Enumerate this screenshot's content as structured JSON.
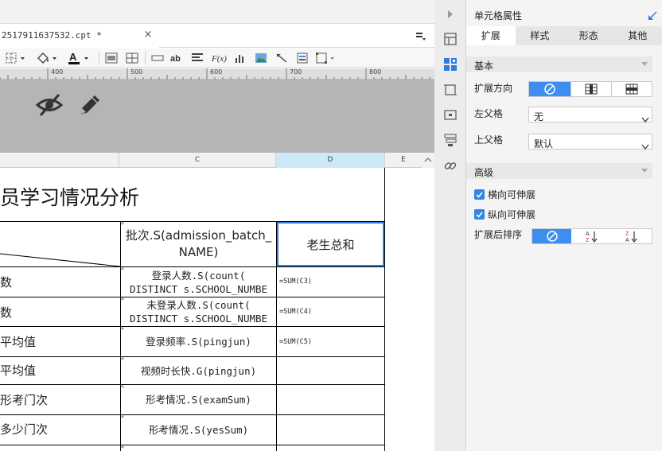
{
  "file_tab": {
    "name": "2517911637532.cpt *",
    "close": "×"
  },
  "columns": [
    "C",
    "D",
    "E"
  ],
  "sheet": {
    "title": "员学习情况分析",
    "header_c": "批次.S(admission_batch_\nNAME)",
    "header_d": "老生总和",
    "star": "*",
    "rows": [
      {
        "label": "数",
        "c": "登录人数.S(count(\nDISTINCT s.SCHOOL_NUMBE",
        "d": "=SUM(C3)"
      },
      {
        "label": "数",
        "c": "未登录人数.S(count(\nDISTINCT s.SCHOOL_NUMBE",
        "d": "=SUM(C4)"
      },
      {
        "label": "平均值",
        "c": "登录频率.S(pingjun)",
        "d": "=SUM(C5)"
      },
      {
        "label": "平均值",
        "c": "视频时长快.G(pingjun)",
        "d": ""
      },
      {
        "label": "形考门次",
        "c": "形考情况.S(examSum)",
        "d": ""
      },
      {
        "label": "多少门次",
        "c": "形考情况.S(yesSum)",
        "d": ""
      }
    ]
  },
  "ruler_labels": [
    "400",
    "500",
    "600",
    "700",
    "800"
  ],
  "panel": {
    "title": "单元格属性",
    "tabs": [
      "扩展",
      "样式",
      "形态",
      "其他"
    ],
    "basic": {
      "header": "基本",
      "expand_direction_label": "扩展方向",
      "left_parent_label": "左父格",
      "left_parent_value": "无",
      "top_parent_label": "上父格",
      "top_parent_value": "默认"
    },
    "advanced": {
      "header": "高级",
      "horizontal_label": "横向可伸展",
      "vertical_label": "纵向可伸展",
      "sort_label": "扩展后排序"
    }
  },
  "colors": {
    "accent": "#3d8ef0",
    "selection": "#2f7de1",
    "column_highlight": "#cde8f6"
  }
}
